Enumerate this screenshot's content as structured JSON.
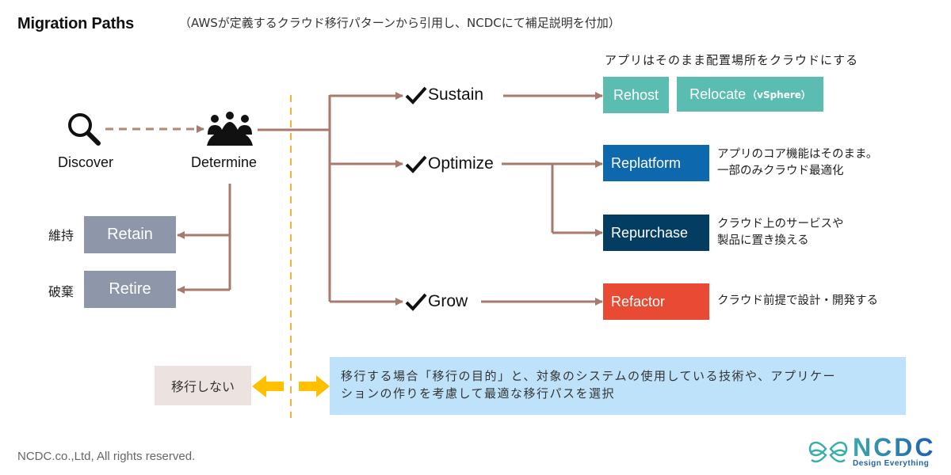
{
  "header": {
    "title": "Migration Paths",
    "subtitle": "（AWSが定義するクラウド移行パターンから引用し、NCDCにて補足説明を付加）"
  },
  "flow": {
    "discover": {
      "label": "Discover",
      "icon": "magnifier-icon"
    },
    "determine": {
      "label": "Determine",
      "icon": "people-group-icon"
    }
  },
  "not_migrate": {
    "retain": {
      "jp": "維持",
      "label": "Retain"
    },
    "retire": {
      "jp": "破棄",
      "label": "Retire"
    },
    "summary": "移行しない"
  },
  "strategies": [
    {
      "label": "Sustain",
      "icon": "checkmark-icon"
    },
    {
      "label": "Optimize",
      "icon": "checkmark-icon"
    },
    {
      "label": "Grow",
      "icon": "checkmark-icon"
    }
  ],
  "patterns": {
    "sustain_note": "アプリはそのまま配置場所をクラウドにする",
    "rehost": "Rehost",
    "relocate": "Relocate",
    "relocate_sub": "（vSphere）",
    "replatform": "Replatform",
    "replatform_note_1": "アプリのコア機能はそのまま。",
    "replatform_note_2": "一部のみクラウド最適化",
    "repurchase": "Repurchase",
    "repurchase_note_1": "クラウド上のサービスや",
    "repurchase_note_2": "製品に置き換える",
    "refactor": "Refactor",
    "refactor_note": "クラウド前提で設計・開発する"
  },
  "migrate_info": {
    "line1": "移行する場合「移行の目的」と、対象のシステムの使用している技術や、アプリケー",
    "line2": "ションの作りを考慮して最適な移行パスを選択"
  },
  "colors": {
    "connector": "#a87a6e",
    "divider": "#f2b134",
    "arrow": "#ffc000",
    "retain_box": "#8e97aa",
    "rehost_box": "#5bbdb1",
    "replatform_box": "#0e68ad",
    "repurchase_box": "#043d62",
    "refactor_box": "#e84a33",
    "info_box": "#bfe2fb",
    "no_migrate_box": "#ece3e0"
  },
  "footer": {
    "copyright": "NCDC.co.,Ltd, All rights reserved.",
    "logo_text": "NCDC",
    "logo_tagline": "Design Everything"
  }
}
